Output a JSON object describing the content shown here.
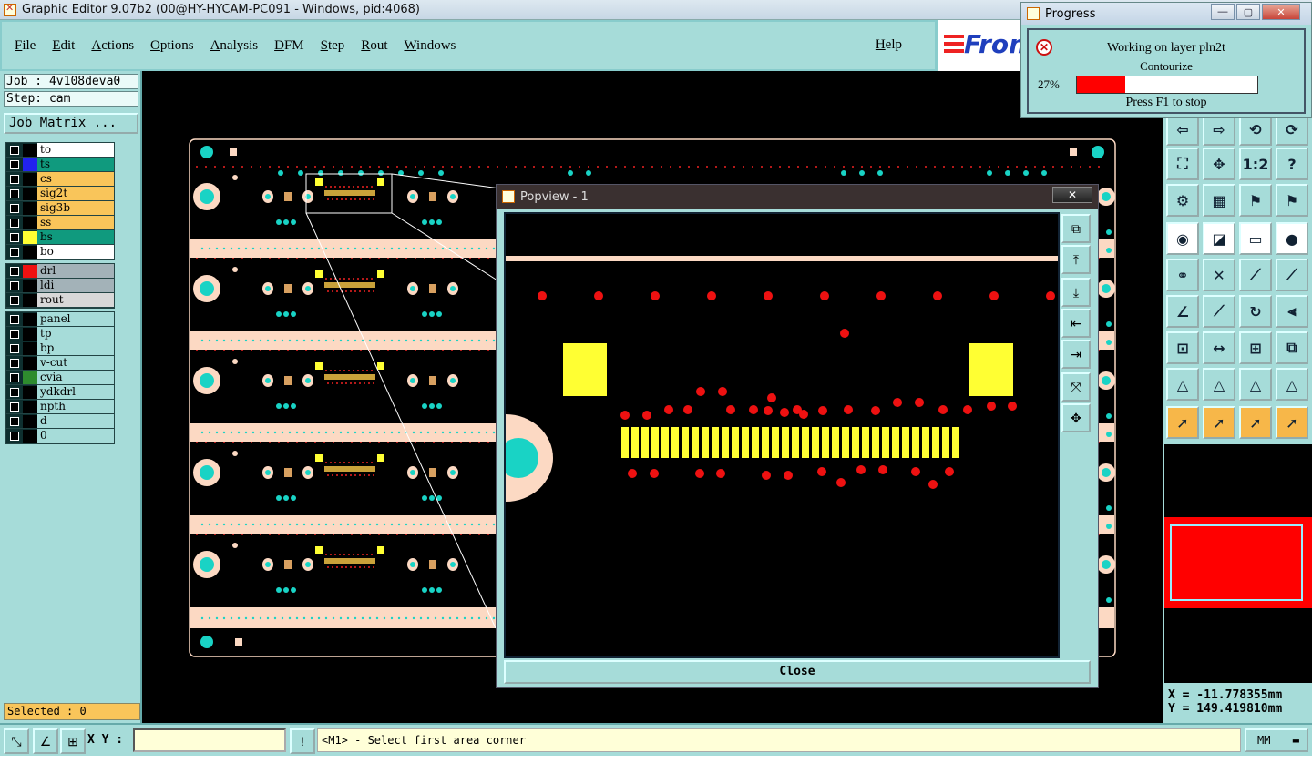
{
  "window": {
    "title": "Graphic Editor 9.07b2 (00@HY-HYCAM-PC091 - Windows, pid:4068)"
  },
  "menu": {
    "items": [
      "File",
      "Edit",
      "Actions",
      "Options",
      "Analysis",
      "DFM",
      "Step",
      "Rout",
      "Windows"
    ],
    "help": "Help"
  },
  "logo": {
    "text": "From"
  },
  "job": {
    "job_line": "Job : 4v108deva0",
    "step_line": "Step: cam",
    "job_matrix": "Job Matrix ..."
  },
  "layers": {
    "group1": [
      {
        "name": "to",
        "color": "#ffffff",
        "swatch": "#000000"
      },
      {
        "name": "ts",
        "color": "#109a7e",
        "swatch": "#2222ee"
      },
      {
        "name": "cs",
        "color": "#f9c55a",
        "swatch": "#000000"
      },
      {
        "name": "sig2t",
        "color": "#f9c55a",
        "swatch": "#000000"
      },
      {
        "name": "sig3b",
        "color": "#f9c55a",
        "swatch": "#000000"
      },
      {
        "name": "ss",
        "color": "#f9c55a",
        "swatch": "#000000"
      },
      {
        "name": "bs",
        "color": "#109a7e",
        "swatch": "#ffff33"
      },
      {
        "name": "bo",
        "color": "#ffffff",
        "swatch": "#000000"
      }
    ],
    "group2": [
      {
        "name": "drl",
        "color": "#a3b2b8",
        "swatch": "#ee1111"
      },
      {
        "name": "ldi",
        "color": "#a3b2b8",
        "swatch": "#000000"
      },
      {
        "name": "rout",
        "color": "#d8d8d8",
        "swatch": "#000000"
      }
    ],
    "group3": [
      {
        "name": "panel",
        "color": "#a6dcd9",
        "swatch": "#000000"
      },
      {
        "name": "tp",
        "color": "#a6dcd9",
        "swatch": "#000000"
      },
      {
        "name": "bp",
        "color": "#a6dcd9",
        "swatch": "#000000"
      },
      {
        "name": "v-cut",
        "color": "#a6dcd9",
        "swatch": "#000000"
      },
      {
        "name": "cvia",
        "color": "#a6dcd9",
        "swatch": "#2e8b2e"
      },
      {
        "name": "ydkdrl",
        "color": "#a6dcd9",
        "swatch": "#000000"
      },
      {
        "name": "npth",
        "color": "#a6dcd9",
        "swatch": "#000000"
      },
      {
        "name": "d",
        "color": "#a6dcd9",
        "swatch": "#000000"
      },
      {
        "name": "0",
        "color": "#a6dcd9",
        "swatch": "#000000"
      }
    ]
  },
  "selected": "Selected : 0",
  "progress": {
    "title": "Progress",
    "line1": "Working on layer pln2t",
    "line2": "Contourize",
    "percent_text": "27%",
    "fraction": 0.27,
    "stop_hint": "Press F1 to stop"
  },
  "popview": {
    "title": "Popview - 1",
    "close_label": "Close"
  },
  "coords": {
    "x": "X = -11.778355mm",
    "y": "Y = 149.419810mm"
  },
  "status": {
    "xy_label": "X Y :",
    "prompt": "<M1> - Select first area corner",
    "units": "MM"
  },
  "colors": {
    "panel_bg": "#a6dcd9",
    "copper_yellow": "#ffff33",
    "drill_red": "#ee1111",
    "pad_cyan": "#19d3c5",
    "substrate_peach": "#fcd9c3"
  },
  "icons": [
    "zoom-in-icon",
    "zoom-out-icon",
    "pan-icon",
    "fit-icon",
    "one-to-one-icon",
    "help-icon",
    "measure-icon",
    "select-icon"
  ]
}
